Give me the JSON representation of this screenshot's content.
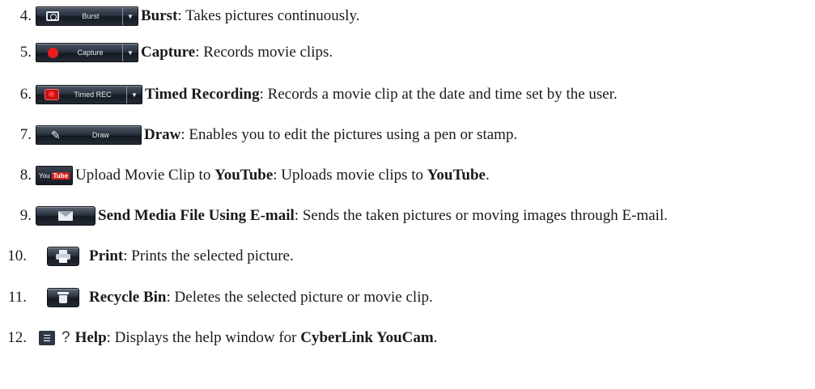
{
  "items": [
    {
      "num": "4.",
      "button_label": "Burst",
      "icon": "camera-icon",
      "bold": "Burst",
      "text": ": Takes pictures continuously."
    },
    {
      "num": "5.",
      "button_label": "Capture",
      "icon": "record-dot-icon",
      "bold": "Capture",
      "text": ": Records movie clips."
    },
    {
      "num": "6.",
      "button_label": "Timed REC",
      "icon": "timed-record-icon",
      "bold": "Timed Recording",
      "text": ": Records a movie clip at the date and time set by the user."
    },
    {
      "num": "7.",
      "button_label": "Draw",
      "icon": "pen-icon",
      "bold": "Draw",
      "text": ": Enables you to edit the pictures using a pen or stamp."
    },
    {
      "num": "8.",
      "yt_left": "You",
      "yt_right": "Tube",
      "pre": "Upload Movie Clip to ",
      "bold": "YouTube",
      "text": ": Uploads movie clips to ",
      "bold2": "YouTube",
      "end": "."
    },
    {
      "num": "9.",
      "icon": "envelope-icon",
      "bold": "Send Media File Using E-mail",
      "text": ": Sends the taken pictures or moving images through E-mail."
    },
    {
      "num": "10.",
      "icon": "printer-icon",
      "bold": "Print",
      "text": ": Prints the selected picture."
    },
    {
      "num": "11.",
      "icon": "trash-icon",
      "bold": "Recycle Bin",
      "text": ": Deletes the selected picture or movie clip."
    },
    {
      "num": "12.",
      "help_q": "?",
      "bold": "Help",
      "text": ": Displays the help window for ",
      "bold2": "CyberLink YouCam",
      "end": "."
    }
  ],
  "colors": {
    "record_red": "#ea1c1c",
    "button_dark": "#151a22"
  }
}
